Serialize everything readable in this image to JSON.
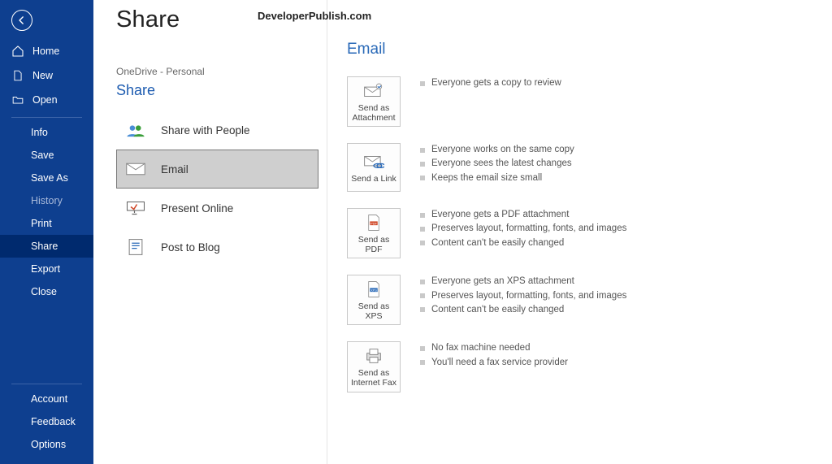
{
  "sidebar": {
    "home": "Home",
    "new": "New",
    "open": "Open",
    "info": "Info",
    "save": "Save",
    "saveas": "Save As",
    "history": "History",
    "print": "Print",
    "share": "Share",
    "export": "Export",
    "close": "Close",
    "account": "Account",
    "feedback": "Feedback",
    "options": "Options"
  },
  "page": {
    "title": "Share",
    "watermark": "DeveloperPublish.com",
    "breadcrumb": "OneDrive - Personal",
    "section_title": "Share"
  },
  "share_items": {
    "people": "Share with People",
    "email": "Email",
    "present": "Present Online",
    "blog": "Post to Blog"
  },
  "right": {
    "title": "Email",
    "opt1": {
      "label": "Send as Attachment",
      "b1": "Everyone gets a copy to review"
    },
    "opt2": {
      "label": "Send a Link",
      "b1": "Everyone works on the same copy",
      "b2": "Everyone sees the latest changes",
      "b3": "Keeps the email size small"
    },
    "opt3": {
      "label": "Send as PDF",
      "b1": "Everyone gets a PDF attachment",
      "b2": "Preserves layout, formatting, fonts, and images",
      "b3": "Content can't be easily changed"
    },
    "opt4": {
      "label": "Send as XPS",
      "b1": "Everyone gets an XPS attachment",
      "b2": "Preserves layout, formatting, fonts, and images",
      "b3": "Content can't be easily changed"
    },
    "opt5": {
      "label": "Send as Internet Fax",
      "b1": "No fax machine needed",
      "b2": "You'll need a fax service provider"
    }
  }
}
